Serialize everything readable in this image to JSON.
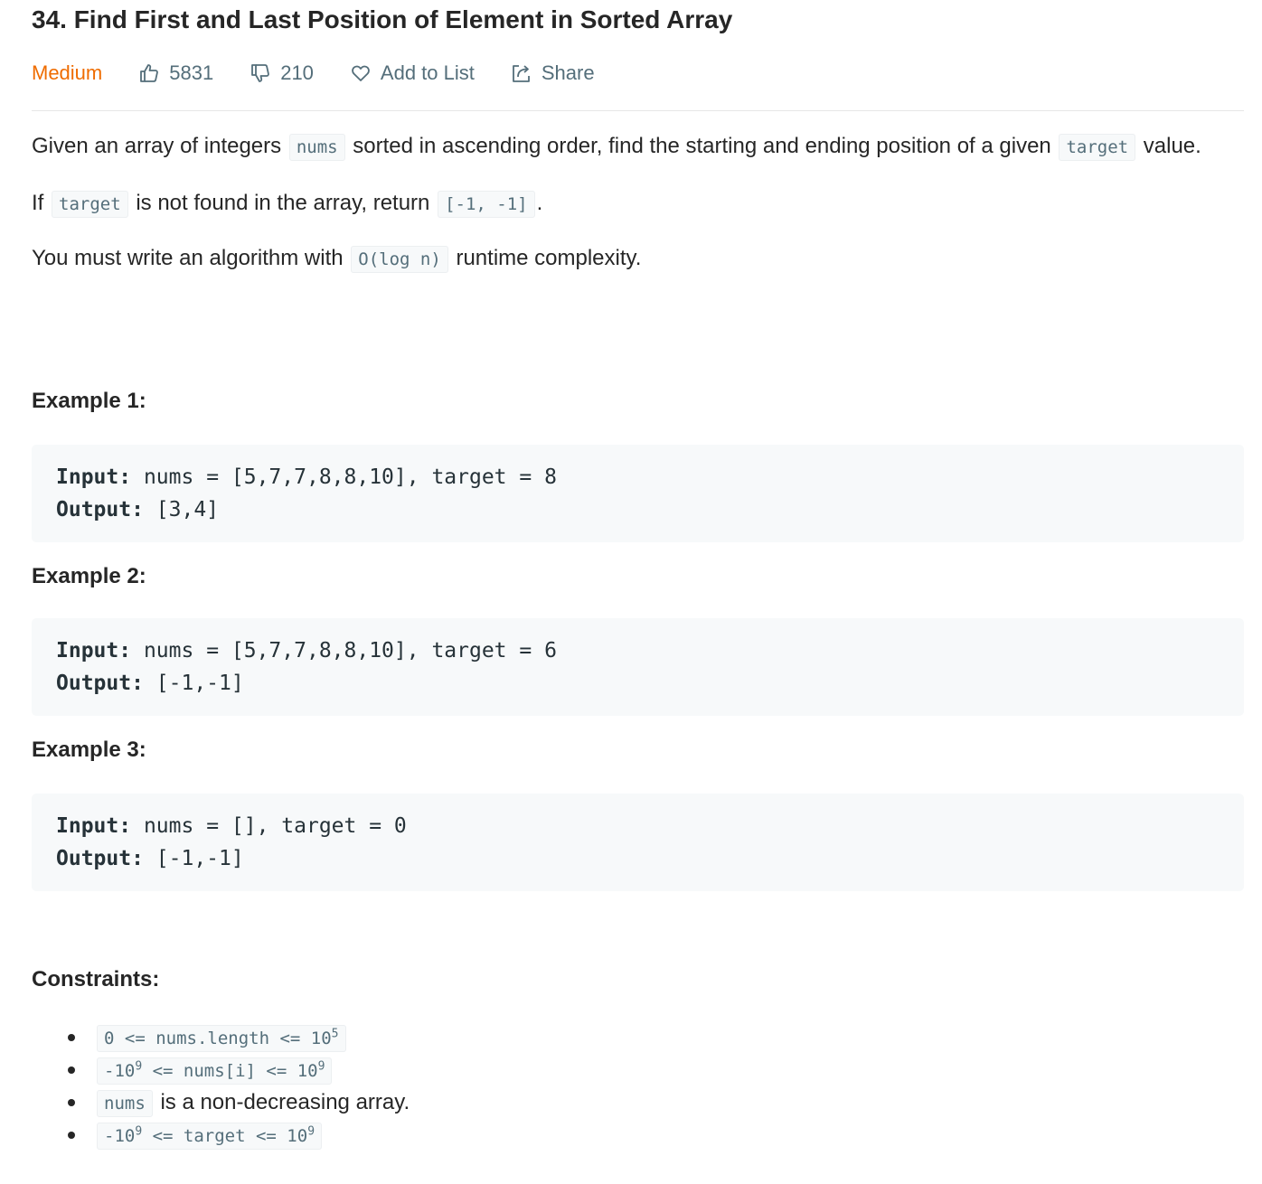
{
  "problem": {
    "title": "34. Find First and Last Position of Element in Sorted Array",
    "difficulty": "Medium",
    "likes": "5831",
    "dislikes": "210",
    "add_to_list": "Add to List",
    "share": "Share"
  },
  "colors": {
    "difficulty_medium": "#ef6c00",
    "meta_text": "#546e7a",
    "code_bg": "#f7f9fa"
  },
  "icons": {
    "like": "thumbs-up-icon",
    "dislike": "thumbs-down-icon",
    "add_to_list": "heart-icon",
    "share": "share-icon"
  },
  "description": {
    "p1_a": "Given an array of integers",
    "p1_code1": "nums",
    "p1_b": "sorted in ascending order, find the starting and ending position of a given",
    "p1_code2": "target",
    "p1_c": "value.",
    "p2_a": "If",
    "p2_code1": "target",
    "p2_b": "is not found in the array, return",
    "p2_code2": "[-1, -1]",
    "p2_c": ".",
    "p3_a": "You must write an algorithm with",
    "p3_code": "O(log n)",
    "p3_b": "runtime complexity."
  },
  "examples": [
    {
      "title": "Example 1:",
      "input_label": "Input:",
      "input": "nums = [5,7,7,8,8,10], target = 8",
      "output_label": "Output:",
      "output": "[3,4]"
    },
    {
      "title": "Example 2:",
      "input_label": "Input:",
      "input": "nums = [5,7,7,8,8,10], target = 6",
      "output_label": "Output:",
      "output": "[-1,-1]"
    },
    {
      "title": "Example 3:",
      "input_label": "Input:",
      "input": "nums = [], target = 0",
      "output_label": "Output:",
      "output": "[-1,-1]"
    }
  ],
  "constraints": {
    "title": "Constraints:",
    "c1_base": "0 <= nums.length <= 10",
    "c1_exp": "5",
    "c2_a": "-10",
    "c2_exp1": "9",
    "c2_b": " <= nums[i] <= 10",
    "c2_exp2": "9",
    "c3_code": "nums",
    "c3_text": "is a non-decreasing array.",
    "c4_a": "-10",
    "c4_exp1": "9",
    "c4_b": " <= target <= 10",
    "c4_exp2": "9"
  }
}
